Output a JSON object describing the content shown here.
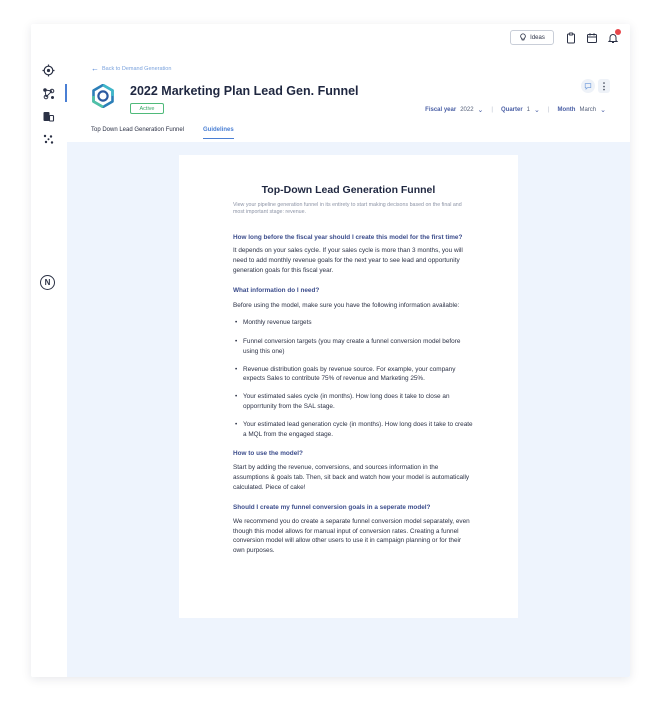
{
  "topbar": {
    "ideas_label": "Ideas",
    "icons": [
      "lightbulb-icon",
      "clipboard-icon",
      "calendar-icon",
      "bell-icon"
    ]
  },
  "sidebar": {
    "items": [
      "target-icon",
      "funnel-nodes-icon",
      "campaign-icon",
      "sparkle-icon"
    ],
    "avatar_letter": "N"
  },
  "header": {
    "back_link": "Back to Demand Generation",
    "plan_title": "2022 Marketing Plan Lead Gen. Funnel",
    "status": "Active",
    "fiscal_year_label": "Fiscal year",
    "fiscal_year_value": "2022",
    "quarter_label": "Quarter",
    "quarter_value": "1",
    "month_label": "Month",
    "month_value": "March",
    "tabs": [
      {
        "label": "Top Down Lead Generation Funnel",
        "active": false
      },
      {
        "label": "Guidelines",
        "active": true
      }
    ]
  },
  "doc": {
    "title": "Top-Down Lead Generation Funnel",
    "subtitle": "View your pipeline generation funnel in its entirety to start making decisons based on the final and most important stage: revenue.",
    "q1": "How long before the fiscal year should I create this model for the first time?",
    "a1": "It depends on your sales cycle. If your sales cycle is more than 3 months, you will need to add monthly revenue goals for the next year to see lead and opportunity generation goals for this fiscal year.",
    "q2": "What information do I need?",
    "a2": "Before using the model, make sure you have the following information available:",
    "bullets": [
      "Monthly revenue targets",
      "Funnel conversion targets (you may create a funnel conversion model before using this one)",
      "Revenue distribution goals by revenue source. For example, your company expects Sales to contribute 75% of revenue and Marketing 25%.",
      "Your estimated sales cycle (in months). How long does it take to close an opporrtunity from the SAL stage.",
      "Your estimated lead generation cycle (in months). How long does it take to create a MQL from the engaged stage."
    ],
    "q3": "How to use the model?",
    "a3": "Start by adding the revenue, conversions, and sources information in the assumptions & goals tab. Then, sit back and watch how your model is automatically calculated. Piece of cake!",
    "q4": "Should I create my funnel conversion goals in a seperate model?",
    "a4": "We recommend you do create a separate funnel conversion model separately, even though this model allows for manual input of conversion rates. Creating a funnel conversion model will allow other users to use it in campaign planning or for their own purposes."
  },
  "colors": {
    "accent": "#4a7fd4",
    "heading": "#3c4d8c",
    "active_badge": "#37a564",
    "notification": "#e8474b",
    "main_bg": "#eef4fd"
  }
}
